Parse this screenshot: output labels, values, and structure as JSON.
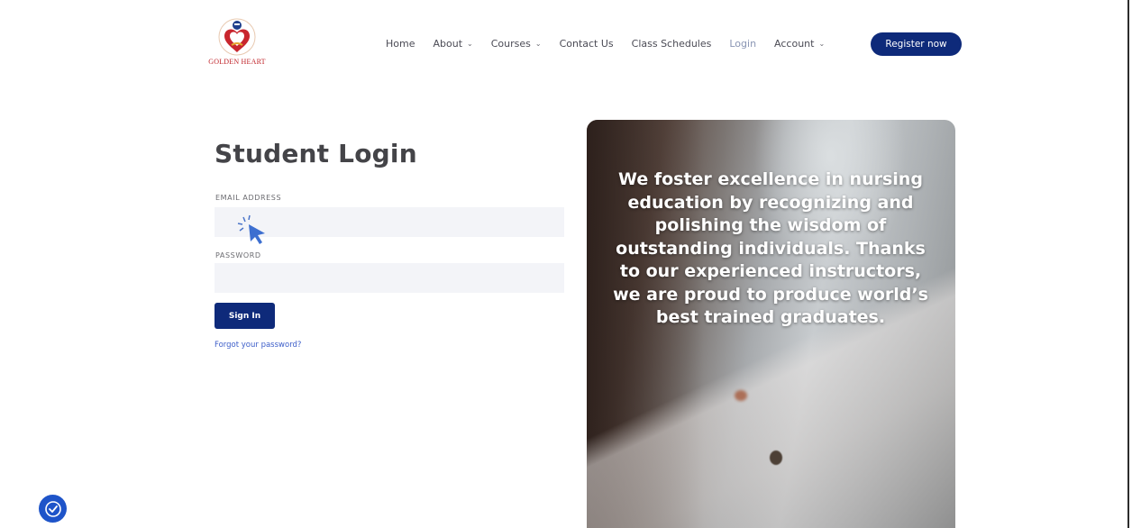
{
  "brand": {
    "logo_text": "GOLDEN HEART"
  },
  "nav": {
    "items": [
      {
        "label": "Home",
        "has_dropdown": false,
        "active": false
      },
      {
        "label": "About",
        "has_dropdown": true,
        "active": false
      },
      {
        "label": "Courses",
        "has_dropdown": true,
        "active": false
      },
      {
        "label": "Contact Us",
        "has_dropdown": false,
        "active": false
      },
      {
        "label": "Class Schedules",
        "has_dropdown": false,
        "active": false
      },
      {
        "label": "Login",
        "has_dropdown": false,
        "active": true
      },
      {
        "label": "Account",
        "has_dropdown": true,
        "active": false
      }
    ],
    "register_label": "Register now"
  },
  "login": {
    "title": "Student Login",
    "email_label": "EMAIL ADDRESS",
    "email_value": "",
    "password_label": "PASSWORD",
    "password_value": "",
    "signin_label": "Sign In",
    "forgot_label": "Forgot your password?"
  },
  "hero": {
    "text": "We foster excellence in nursing education by recognizing and polishing the wisdom of outstanding individuals. Thanks to our experienced instructors, we are proud to produce world’s best trained graduates."
  },
  "colors": {
    "primary": "#0e2a7a",
    "link": "#3d5ec9",
    "nav_active": "#8a95b3",
    "input_bg": "#f3f4f8",
    "a11y": "#1e54c9"
  },
  "icons": {
    "logo": "golden-heart-logo",
    "dropdown": "chevron-down-icon",
    "cursor": "pointer-cursor-icon",
    "accessibility": "accessibility-icon"
  }
}
